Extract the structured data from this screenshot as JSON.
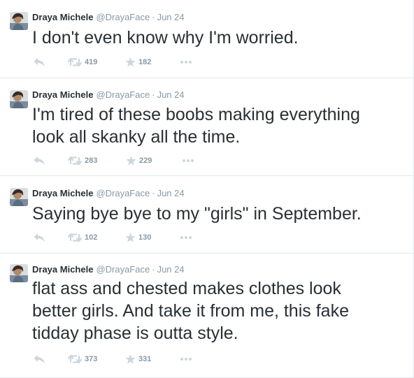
{
  "icons": {
    "reply": "reply-icon",
    "retweet": "retweet-icon",
    "favorite": "star-icon",
    "more": "more-icon"
  },
  "colors": {
    "text": "#292f33",
    "muted": "#8899a6",
    "icon": "#ccd6dd",
    "divider": "#e1e8ed"
  },
  "tweets": [
    {
      "fullname": "Draya Michele",
      "username": "@DrayaFace",
      "separator": "·",
      "time": "Jun 24",
      "text": "I don't even know why I'm worried.",
      "retweets": "419",
      "favorites": "182"
    },
    {
      "fullname": "Draya Michele",
      "username": "@DrayaFace",
      "separator": "·",
      "time": "Jun 24",
      "text": "I'm tired of these boobs making everything\nlook all skanky all the time.",
      "retweets": "283",
      "favorites": "229"
    },
    {
      "fullname": "Draya Michele",
      "username": "@DrayaFace",
      "separator": "·",
      "time": "Jun 24",
      "text": "Saying bye bye to my \"girls\" in September.",
      "retweets": "102",
      "favorites": "130"
    },
    {
      "fullname": "Draya Michele",
      "username": "@DrayaFace",
      "separator": "·",
      "time": "Jun 24",
      "text": "flat ass and chested makes clothes look\nbetter girls. And take it from me, this fake\ntidday phase is outta style.",
      "retweets": "373",
      "favorites": "331"
    }
  ]
}
